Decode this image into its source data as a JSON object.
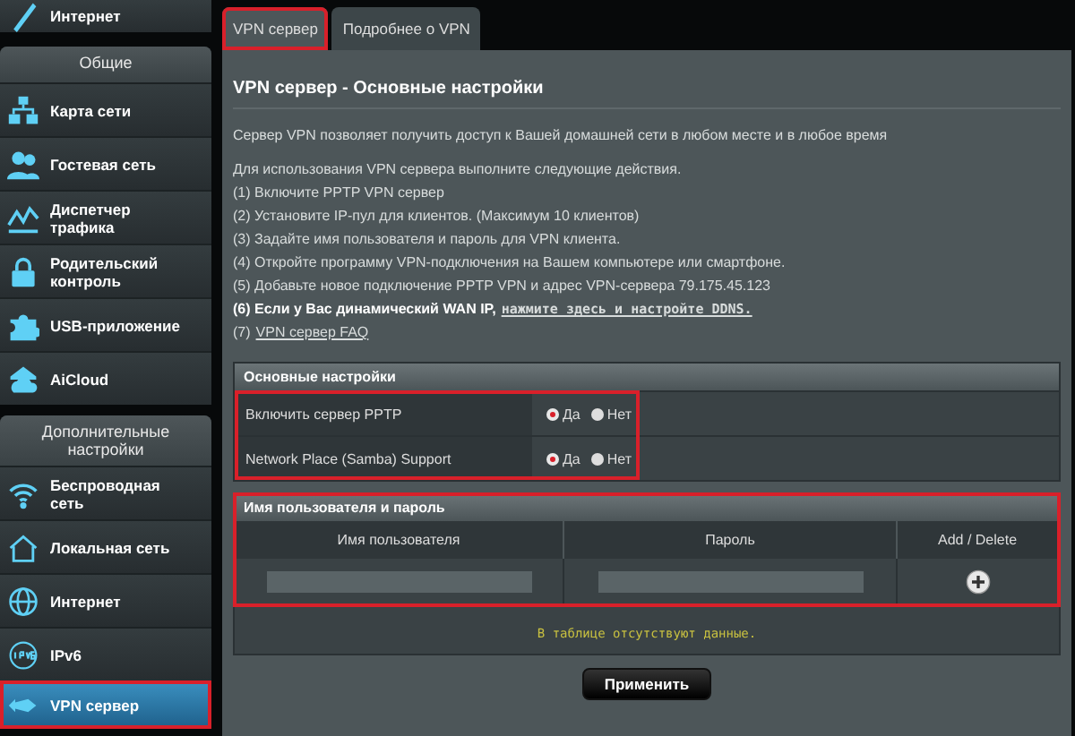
{
  "sidebar": {
    "top_item": {
      "label": "Интернет"
    },
    "groups": [
      {
        "title": "Общие",
        "items": [
          {
            "label": "Карта сети",
            "selected": false
          },
          {
            "label": "Гостевая сеть",
            "selected": false
          },
          {
            "label": "Диспетчер трафика",
            "selected": false
          },
          {
            "label": "Родительский контроль",
            "selected": false
          },
          {
            "label": "USB-приложение",
            "selected": false
          },
          {
            "label": "AiCloud",
            "selected": false
          }
        ]
      },
      {
        "title": "Дополнительные настройки",
        "items": [
          {
            "label": "Беспроводная сеть",
            "selected": false
          },
          {
            "label": "Локальная сеть",
            "selected": false
          },
          {
            "label": "Интернет",
            "selected": false
          },
          {
            "label": "IPv6",
            "selected": false
          },
          {
            "label": "VPN сервер",
            "selected": true
          }
        ]
      }
    ]
  },
  "tabs": [
    {
      "label": "VPN сервер",
      "selected": true
    },
    {
      "label": "Подробнее о VPN",
      "selected": false
    }
  ],
  "page_title": "VPN сервер - Основные настройки",
  "intro": "Сервер VPN позволяет получить доступ к Вашей домашней сети в любом месте и в любое время",
  "steps_heading": "Для использования VPN сервера выполните следующие действия.",
  "steps": [
    {
      "text": "(1) Включите PPTP VPN сервер",
      "bold": false
    },
    {
      "text": "(2) Установите IP-пул для клиентов. (Максимум 10 клиентов)",
      "bold": false
    },
    {
      "text": "(3) Задайте имя пользователя и пароль для VPN клиента.",
      "bold": false
    },
    {
      "text": "(4) Откройте программу VPN-подключения на Вашем компьютере или смартфоне.",
      "bold": false
    },
    {
      "text": "(5) Добавьте новое подключение PPTP VPN и адрес VPN-сервера 79.175.45.123",
      "bold": false
    },
    {
      "text": "(6) Если у Вас динамический WAN IP,",
      "link": "нажмите здесь и настройте DDNS.",
      "bold": true
    },
    {
      "text": "(7)",
      "link": "VPN сервер FAQ",
      "bold": false
    }
  ],
  "basic_settings": {
    "title": "Основные настройки",
    "highlighted": true,
    "rows": [
      {
        "label": "Включить сервер PPTP",
        "options": [
          {
            "label": "Да",
            "selected": true
          },
          {
            "label": "Нет",
            "selected": false
          }
        ]
      },
      {
        "label": "Network Place (Samba) Support",
        "options": [
          {
            "label": "Да",
            "selected": true
          },
          {
            "label": "Нет",
            "selected": false
          }
        ]
      }
    ]
  },
  "users": {
    "title": "Имя пользователя и пароль",
    "highlighted": true,
    "columns": [
      "Имя пользователя",
      "Пароль",
      "Add / Delete"
    ],
    "empty_message": "В таблице отсутствуют данные."
  },
  "apply_button": "Применить"
}
